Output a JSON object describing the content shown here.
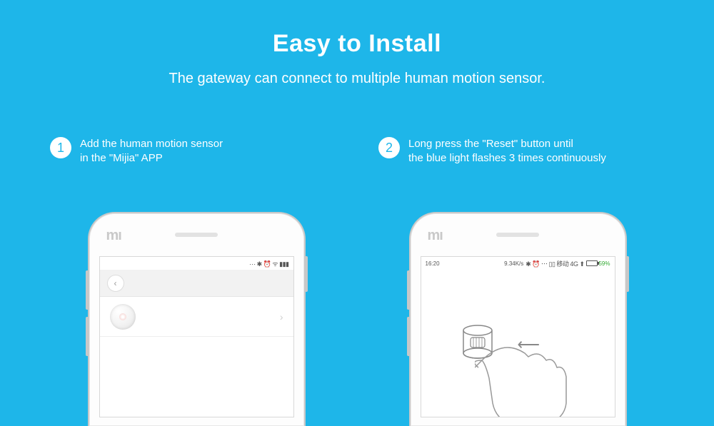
{
  "header": {
    "title": "Easy to Install",
    "subtitle": "The gateway can connect to multiple human motion sensor."
  },
  "steps": [
    {
      "num": "1",
      "text": "Add the human motion sensor\n in the \"Mijia\" APP"
    },
    {
      "num": "2",
      "text": "Long press the \"Reset\" button until\nthe blue light flashes 3 times continuously"
    }
  ],
  "phone1": {
    "logo": "mı",
    "status_icons": "⋯ ✱ ⏰ ᯤ ▮▮▮"
  },
  "phone2": {
    "logo": "mı",
    "status_time": "16:20",
    "status_speed": "9.34K/s",
    "status_icons": "✱ ⏰ ⋯ ▯▯ 移动 4G ⬆",
    "battery_pct": "59%"
  }
}
